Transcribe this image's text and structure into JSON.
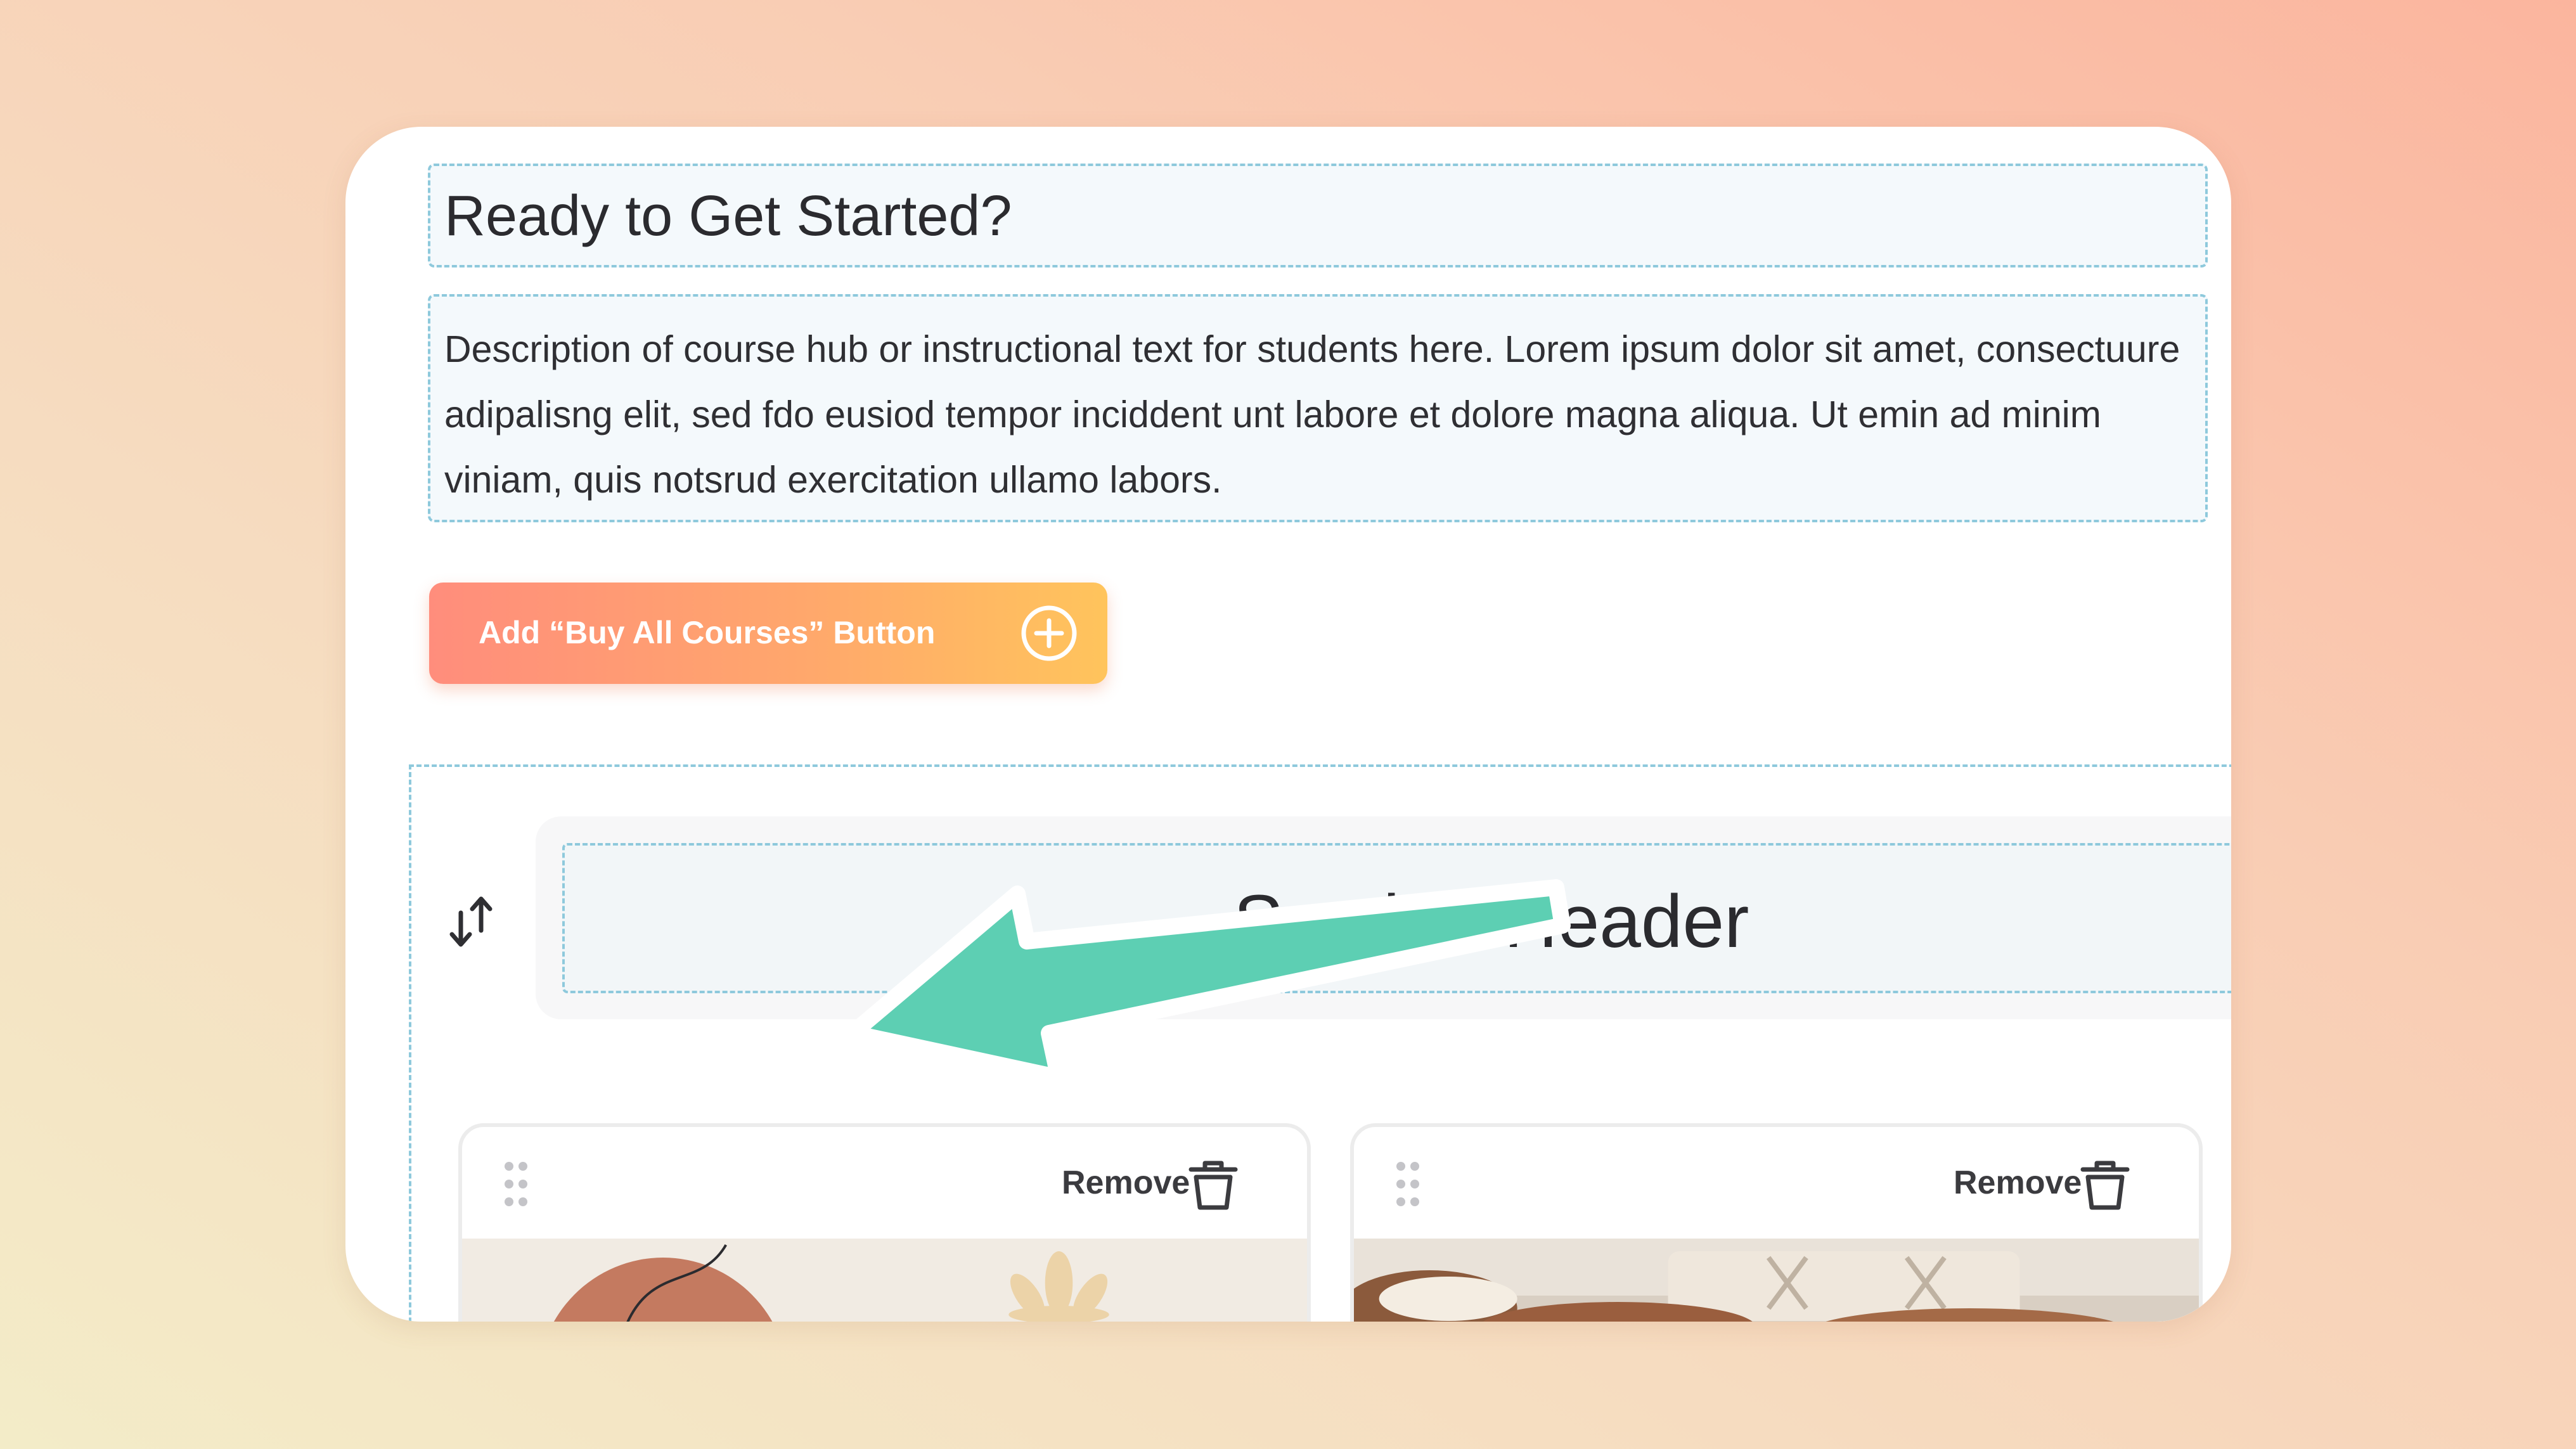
{
  "content": {
    "heading": "Ready to Get Started?",
    "description": "Description of course hub or instructional text for students here. Lorem ipsum dolor sit amet, consectuure adipalisng elit, sed fdo eusiod tempor inciddent unt labore et dolore magna aliqua. Ut emin ad minim viniam, quis notsrud exercitation ullamo labors."
  },
  "buy_button": {
    "label": "Add “Buy All Courses” Button",
    "icon": "plus-circle-icon"
  },
  "section": {
    "header": "Section Header",
    "reorder_icon": "reorder-arrows-icon"
  },
  "course_cards": [
    {
      "remove_label": "Remove",
      "drag_icon": "drag-handle-icon",
      "remove_icon": "trash-icon"
    },
    {
      "remove_label": "Remove",
      "drag_icon": "drag-handle-icon",
      "remove_icon": "trash-icon"
    }
  ],
  "colors": {
    "accent_start": "#ff8d7c",
    "accent_end": "#ffc45c",
    "annotation_arrow": "#5dcfb3",
    "dashed_border": "#8ec9dc"
  }
}
